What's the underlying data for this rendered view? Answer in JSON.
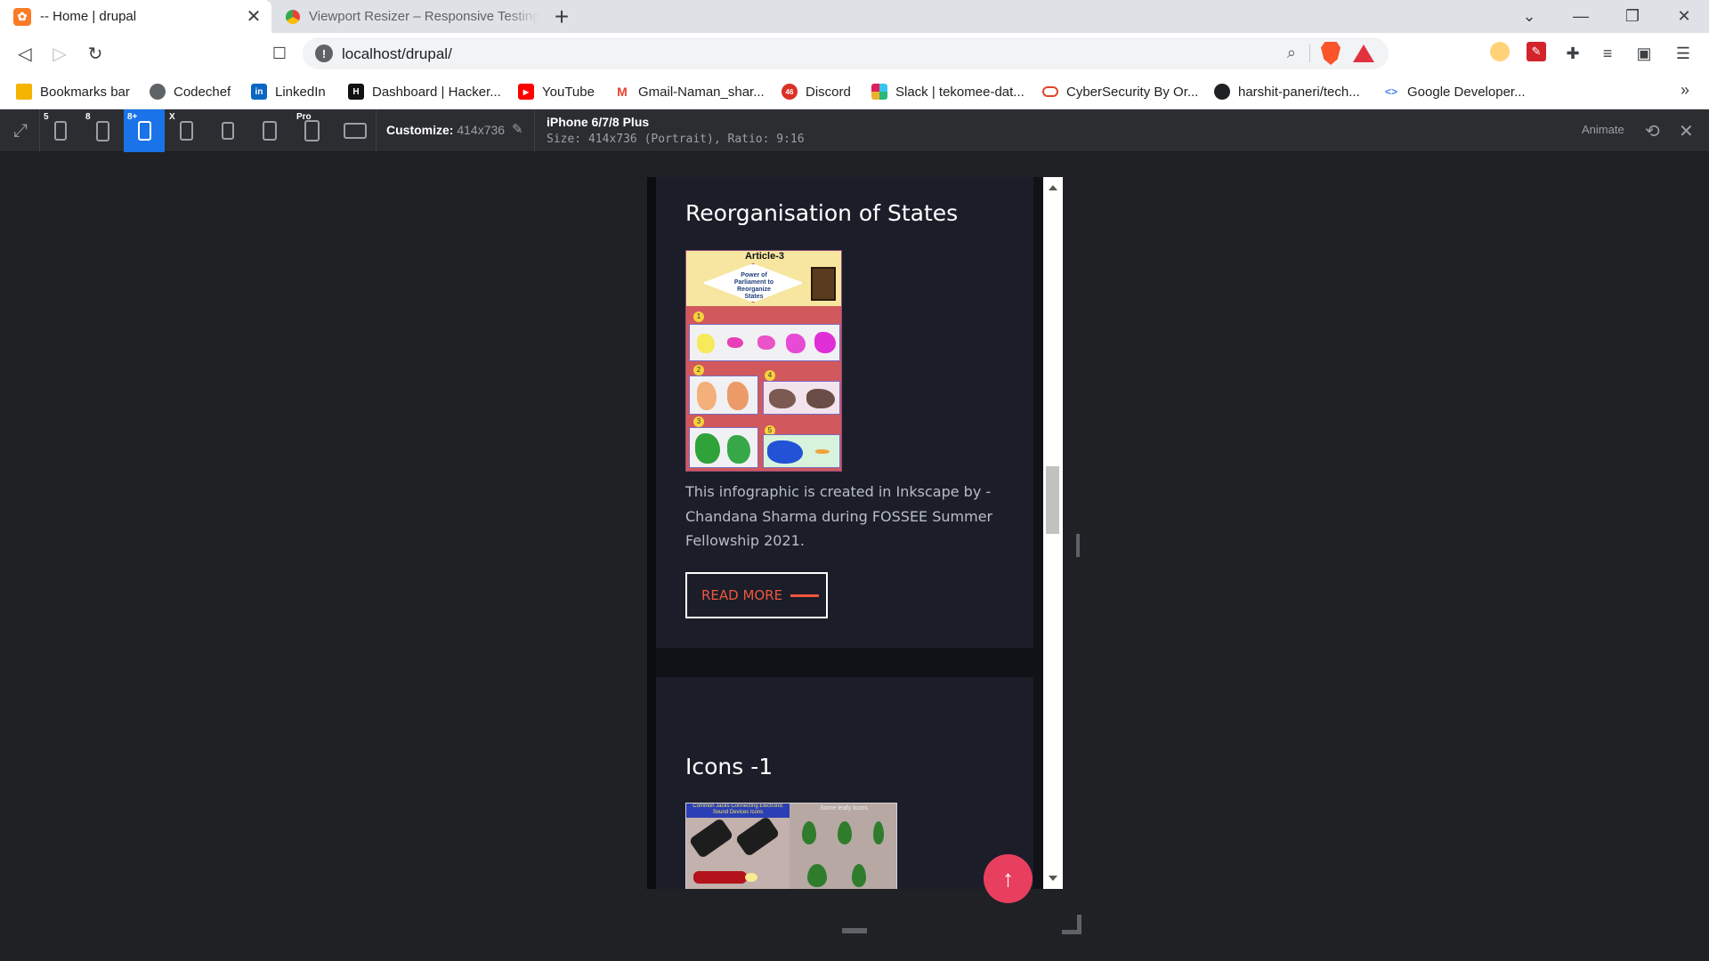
{
  "browser": {
    "tabs": [
      {
        "title": "-- Home | drupal",
        "close": "✕"
      },
      {
        "title": "Viewport Resizer – Responsive Testing"
      }
    ],
    "new_tab": "+",
    "url": "localhost/drupal/",
    "window_controls": {
      "dropdown": "⌄",
      "minimize": "—",
      "restore": "❐",
      "close": "✕"
    }
  },
  "bookmarks": [
    {
      "label": "Bookmarks bar",
      "icon": "folder-icon",
      "color": "#f4b400"
    },
    {
      "label": "Codechef",
      "icon": "globe-icon",
      "color": "#5f6368"
    },
    {
      "label": "LinkedIn",
      "icon": "linkedin-icon",
      "color": "#0a66c2"
    },
    {
      "label": "Dashboard | Hacker...",
      "icon": "hackerrank-icon",
      "color": "#1ba94c"
    },
    {
      "label": "YouTube",
      "icon": "youtube-icon",
      "color": "#ff0000"
    },
    {
      "label": "Gmail-Naman_shar...",
      "icon": "gmail-icon",
      "color": "#ea4335"
    },
    {
      "label": "Discord",
      "icon": "discord-icon",
      "color": "#d93025",
      "badge": "46"
    },
    {
      "label": "Slack | tekomee-dat...",
      "icon": "slack-icon",
      "color": "#4a154b"
    },
    {
      "label": "CyberSecurity By Or...",
      "icon": "oracle-icon",
      "color": "#e0462a"
    },
    {
      "label": "harshit-paneri/tech...",
      "icon": "github-icon",
      "color": "#202124"
    },
    {
      "label": "Google Developer...",
      "icon": "google-dev-icon",
      "color": "#4285f4"
    }
  ],
  "bookmarks_more": "»",
  "resizer": {
    "device_labels": [
      "5",
      "8",
      "8+",
      "X",
      "",
      "",
      "Pro",
      ""
    ],
    "customize_label": "Customize:",
    "customize_value": "414x736",
    "device_name": "iPhone 6/7/8 Plus",
    "device_size": "Size: 414x736 (Portrait), Ratio: 9:16",
    "animate": "Animate"
  },
  "page": {
    "card1": {
      "title": "Reorganisation of States",
      "image_heading": "Article-3",
      "image_center_text": "Power of Parliament to Reorganize States",
      "description": "This infographic is created in Inkscape by - Chandana Sharma during FOSSEE Summer Fellowship 2021.",
      "read_more": "READ MORE"
    },
    "card2": {
      "title": "Icons -1",
      "image_left_heading": "Common Jacks Connecting Electronic Sound Devices Icons",
      "image_right_heading": "Some leafy Icons"
    },
    "back_to_top": "↑"
  },
  "colors": {
    "accent": "#f0563d",
    "back_to_top": "#e93f5f",
    "card_bg": "#1b1d29",
    "page_bg": "#111218",
    "active_device": "#1a73e8"
  }
}
